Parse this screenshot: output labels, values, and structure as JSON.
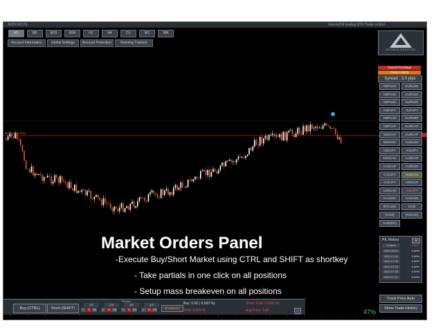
{
  "window": {
    "title": "AUDCAD,H1",
    "title_right": "AriemaTM trading MT4 Trade control"
  },
  "timeframes": [
    "M1",
    "M5",
    "M15",
    "M30",
    "H1",
    "H4",
    "D1",
    "W1",
    "MN"
  ],
  "top_buttons": [
    "Account Information",
    "Global Settings",
    "Account Protection",
    "Running Trade(s)"
  ],
  "logo": {
    "text": "ARTEMIS INVESTING"
  },
  "right_panel": {
    "cancel_pending": "Cancel Pendings",
    "cancel_alerts": "Cancel Alerts",
    "spread": "Spread : 3.0 pips",
    "pairs": [
      [
        "GBPUSD",
        "EURUSD"
      ],
      [
        "GBPAUD",
        "EURAUD"
      ],
      [
        "GBPNZD",
        "EURNZD"
      ],
      [
        "GBPJPY",
        "EURJPY"
      ],
      [
        "GBPCAD",
        "EURGBP"
      ],
      [
        "GBPCHF",
        "EURCAD"
      ],
      [
        "NZDCHF",
        "EURCHF"
      ],
      [
        "NZDUSD",
        "AUDUSD"
      ],
      [
        "NZDJPY",
        "AUDJPY"
      ],
      [
        "NZDCAD",
        "AUDCHF"
      ],
      [
        "CADCHF",
        "AUDNZD"
      ],
      [
        "CADJPY",
        "AUDCAD"
      ],
      [
        "CHFJPY",
        "USDCHF"
      ],
      [
        "USDCAD",
        "USDJPY"
      ],
      [
        "XAUUSD",
        "XAGUSD"
      ],
      [
        "BTCUSD",
        "DJ30"
      ],
      [
        "[DJ30]",
        "[NIG100]"
      ]
    ],
    "last_item": "DJ30(DE)"
  },
  "history": {
    "title": "P/L History",
    "current_label": "Current",
    "current_value": "-0.00%",
    "rows": [
      {
        "date": "2022.06.01",
        "value": "0.00%"
      },
      {
        "date": "2022.07.01",
        "value": "0.00%"
      },
      {
        "date": "2022.07.28",
        "value": "0.00%"
      },
      {
        "date": "2022.07.29",
        "value": "0.00%"
      },
      {
        "date": "2022.07.30",
        "value": "0.00%"
      },
      {
        "date": "2022.07.31",
        "value": "0.00%"
      }
    ]
  },
  "buttons": {
    "track_price": "Track Price Auto",
    "show_history": "Show Trade History"
  },
  "percent": "47%",
  "bottom_panel": {
    "buy": "Buy (CTRL)",
    "short": "Short (SHIFT)",
    "partials_label": "Partials",
    "partials": [
      "1/4",
      "2/4",
      "3/4",
      "4/4"
    ],
    "buy_info": "Buy: 0.00 ( 0.000 %)",
    "short_info": "Short: 0.00 ( 0.000 %)",
    "total": "Total: 0.000 %",
    "avg": "Avg Price: 0.00",
    "breakeven": "Breakeven"
  },
  "price_line_label": "AUDCAD 0.9134",
  "overlay": {
    "title": "Market Orders Panel",
    "lines": [
      "-Execute Buy/Short Market using CTRL and SHIFT as shortkey",
      "- Take partials in one click on all positions",
      "- Setup mass breakeven on all positions"
    ]
  },
  "colors": {
    "bull": "#ffffff",
    "bear": "#e06030",
    "price_line": "#c81e1e",
    "cancel_pending": "#c62828",
    "cancel_alerts": "#d67a12",
    "percent": "#39d15a"
  }
}
